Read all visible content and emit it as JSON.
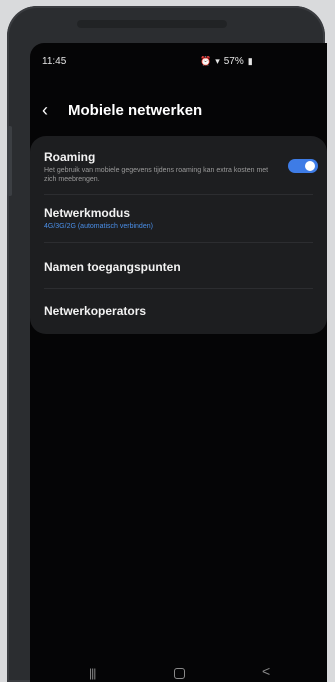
{
  "status": {
    "time": "11:45",
    "battery": "57%"
  },
  "header": {
    "back_icon": "chevron-left-icon",
    "title": "Mobiele netwerken"
  },
  "settings": {
    "roaming": {
      "title": "Roaming",
      "description": "Het gebruik van mobiele gegevens tijdens roaming kan extra kosten met zich meebrengen.",
      "enabled": true
    },
    "network_mode": {
      "title": "Netwerkmodus",
      "value": "4G/3G/2G (automatisch verbinden)"
    },
    "apn": {
      "title": "Namen toegangspunten"
    },
    "operators": {
      "title": "Netwerkoperators"
    }
  },
  "colors": {
    "accent": "#3e7ce6",
    "card": "#1d1e20",
    "background": "#050506"
  },
  "navbar": {
    "recent": "|||",
    "back": "<"
  }
}
